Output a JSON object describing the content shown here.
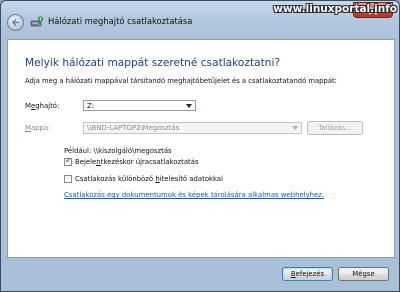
{
  "window": {
    "title": "Hálózati meghajtó csatlakoztatása",
    "watermark": "www.linuxportal.info"
  },
  "main": {
    "heading": "Melyik hálózati mappát szeretné csatlakoztatni?",
    "instructions": "Adja meg a hálózati mappával társítandó meghajtóbetűjelet és a csatlakoztatandó mappát:",
    "drive": {
      "label_pre": "M",
      "label_ul": "e",
      "label_post": "ghajtó:",
      "value": "Z:"
    },
    "folder": {
      "label_pre": "",
      "label_ul": "M",
      "label_post": "appa:",
      "value": "\\\\BND-LAPTOP2\\Megosztás"
    },
    "browse_label": "Tallózás...",
    "example": "Például: \\\\kiszolgáló\\megosztás",
    "reconnect": {
      "label_pre": "Bejele",
      "label_ul": "n",
      "label_post": "tkezéskor újracsatlakoztatás",
      "checked": true
    },
    "credentials": {
      "label_pre": "Csatlakozás különböző ",
      "label_ul": "h",
      "label_post": "itelesítő adatokkal",
      "checked": false
    },
    "link": "Csatlakozás egy dokumentumok és képek tárolására alkalmas webhelyhez."
  },
  "footer": {
    "finish_pre": "",
    "finish_ul": "B",
    "finish_post": "efejezés",
    "cancel_label": "Mégse"
  },
  "icons": {
    "back": "back-arrow-icon",
    "title": "network-drive-icon",
    "close": "close-icon"
  }
}
